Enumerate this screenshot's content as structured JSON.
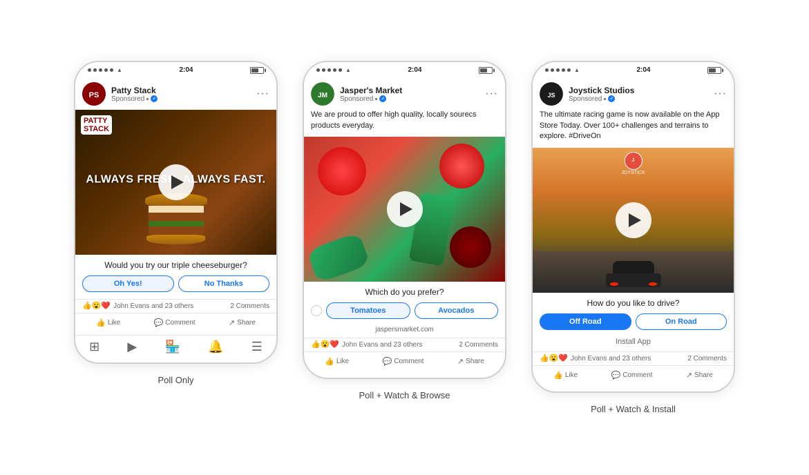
{
  "phones": [
    {
      "id": "phone1",
      "time": "2:04",
      "advertiser": {
        "name": "Patty Stack",
        "sponsored": "Sponsored",
        "avatar_letter": "PS",
        "avatar_bg": "#8B0000"
      },
      "post_text": null,
      "video": {
        "type": "burger",
        "overlay_line1": "ALWAYS FRESH. ALWAYS FAST.",
        "logo_text": "PATTY",
        "logo_sub": "STACK"
      },
      "poll": {
        "question": "Would you try our triple cheeseburger?",
        "options": [
          "Oh Yes!",
          "No Thanks"
        ]
      },
      "link": null,
      "install": null,
      "reactions": "John Evans and 23 others",
      "comments": "2 Comments",
      "has_bottom_nav": true
    },
    {
      "id": "phone2",
      "time": "2:04",
      "advertiser": {
        "name": "Jasper's Market",
        "sponsored": "Sponsored",
        "avatar_letter": "JM",
        "avatar_bg": "#2d7a2d"
      },
      "post_text": "We are proud to offer high quality, locally sourecs products everyday.",
      "video": {
        "type": "veggies",
        "overlay_line1": null
      },
      "poll": {
        "question": "Which do you prefer?",
        "options": [
          "Tomatoes",
          "Avocados"
        ],
        "has_radio": true
      },
      "link": "jaspersmarket.com",
      "install": null,
      "reactions": "John Evans and 23 others",
      "comments": "2 Comments",
      "has_bottom_nav": false
    },
    {
      "id": "phone3",
      "time": "2:04",
      "advertiser": {
        "name": "Joystick Studios",
        "sponsored": "Sponsored",
        "avatar_letter": "JS",
        "avatar_bg": "#222"
      },
      "post_text": "The ultimate racing game is now available on the App Store Today. Over 100+ challenges and terrains to explore. #DriveOn",
      "video": {
        "type": "racing",
        "overlay_line1": null,
        "game_logo": "JOYSTICK"
      },
      "poll": {
        "question": "How do you like to drive?",
        "options": [
          "Off Road",
          "On Road"
        ]
      },
      "link": null,
      "install": "Install App",
      "reactions": "John Evans and 23 others",
      "comments": "2 Comments",
      "has_bottom_nav": false
    }
  ],
  "labels": [
    "Poll Only",
    "Poll + Watch & Browse",
    "Poll + Watch & Install"
  ],
  "label_bold": [
    "Poll",
    "Poll",
    "Poll"
  ]
}
